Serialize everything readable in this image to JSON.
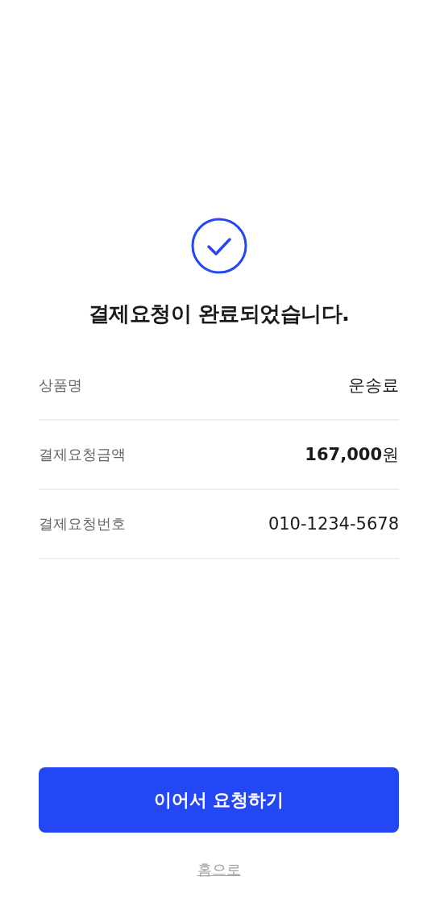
{
  "title": "결제요청이 완료되었습니다.",
  "details": [
    {
      "label": "상품명",
      "value": "운송료"
    },
    {
      "label": "결제요청금액",
      "value": "**167,000**원"
    },
    {
      "label": "결제요청번호",
      "value": "010-1234-5678"
    }
  ],
  "primary_button": "이어서 요청하기",
  "home_link": "홈으로"
}
